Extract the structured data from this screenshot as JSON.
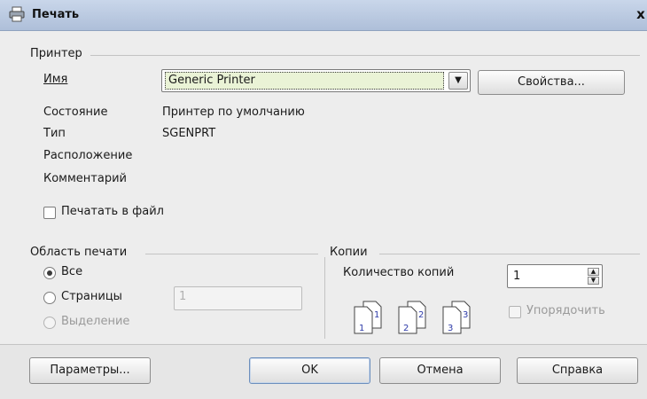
{
  "window": {
    "title": "Печать",
    "close_glyph": "x",
    "icon": "printer-icon"
  },
  "printer": {
    "group_label": "Принтер",
    "name_label": "Имя",
    "name_value": "Generic Printer",
    "properties_button": "Свойства...",
    "status_label": "Состояние",
    "status_value": "Принтер по умолчанию",
    "type_label": "Тип",
    "type_value": "SGENPRT",
    "location_label": "Расположение",
    "comment_label": "Комментарий",
    "print_to_file_label": "Печатать в файл",
    "print_to_file_checked": false
  },
  "print_range": {
    "group_label": "Область печати",
    "all_label": "Все",
    "pages_label": "Страницы",
    "pages_value": "1",
    "selection_label": "Выделение",
    "selected": "all"
  },
  "copies": {
    "group_label": "Копии",
    "count_label": "Количество копий",
    "count_value": "1",
    "collate_label": "Упорядочить",
    "collate_checked": false,
    "page_numbers": [
      "1",
      "1",
      "2",
      "2",
      "3",
      "3"
    ]
  },
  "buttons": {
    "options": "Параметры...",
    "ok": "OK",
    "cancel": "Отмена",
    "help": "Справка"
  },
  "colors": {
    "title_bar": "#aebfd9",
    "field_highlight": "#eaf3d6",
    "default_button_border": "#6d8fbd"
  }
}
